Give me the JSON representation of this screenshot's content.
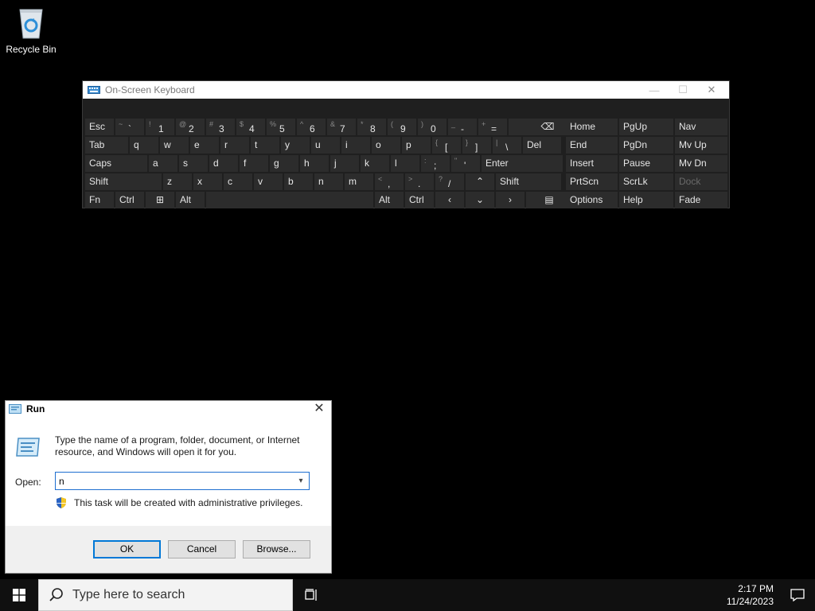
{
  "desktop": {
    "recycle_bin_label": "Recycle Bin"
  },
  "osk": {
    "title": "On-Screen Keyboard",
    "rows": [
      [
        {
          "label": "Esc"
        },
        {
          "shift": "~",
          "main": "`"
        },
        {
          "shift": "!",
          "main": "1"
        },
        {
          "shift": "@",
          "main": "2"
        },
        {
          "shift": "#",
          "main": "3"
        },
        {
          "shift": "$",
          "main": "4"
        },
        {
          "shift": "%",
          "main": "5"
        },
        {
          "shift": "^",
          "main": "6"
        },
        {
          "shift": "&",
          "main": "7"
        },
        {
          "shift": "*",
          "main": "8"
        },
        {
          "shift": "(",
          "main": "9"
        },
        {
          "shift": ")",
          "main": "0"
        },
        {
          "shift": "_",
          "main": "-"
        },
        {
          "shift": "+",
          "main": "="
        },
        {
          "label": "⌫",
          "icon": "backspace-icon"
        }
      ],
      [
        {
          "label": "Tab"
        },
        {
          "label": "q"
        },
        {
          "label": "w"
        },
        {
          "label": "e"
        },
        {
          "label": "r"
        },
        {
          "label": "t"
        },
        {
          "label": "y"
        },
        {
          "label": "u"
        },
        {
          "label": "i"
        },
        {
          "label": "o"
        },
        {
          "label": "p"
        },
        {
          "shift": "{",
          "main": "["
        },
        {
          "shift": "}",
          "main": "]"
        },
        {
          "shift": "|",
          "main": "\\"
        },
        {
          "label": "Del"
        }
      ],
      [
        {
          "label": "Caps"
        },
        {
          "label": "a"
        },
        {
          "label": "s"
        },
        {
          "label": "d"
        },
        {
          "label": "f"
        },
        {
          "label": "g"
        },
        {
          "label": "h"
        },
        {
          "label": "j"
        },
        {
          "label": "k"
        },
        {
          "label": "l"
        },
        {
          "shift": ":",
          "main": ";"
        },
        {
          "shift": "\"",
          "main": "'"
        },
        {
          "label": "Enter"
        }
      ],
      [
        {
          "label": "Shift"
        },
        {
          "label": "z"
        },
        {
          "label": "x"
        },
        {
          "label": "c"
        },
        {
          "label": "v"
        },
        {
          "label": "b"
        },
        {
          "label": "n"
        },
        {
          "label": "m"
        },
        {
          "shift": "<",
          "main": ","
        },
        {
          "shift": ">",
          "main": "."
        },
        {
          "shift": "?",
          "main": "/"
        },
        {
          "label": "⌃",
          "icon": "arrow-up-icon"
        },
        {
          "label": "Shift"
        }
      ],
      [
        {
          "label": "Fn"
        },
        {
          "label": "Ctrl"
        },
        {
          "label": "⊞",
          "icon": "windows-logo-icon"
        },
        {
          "label": "Alt"
        },
        {
          "label": "",
          "icon": "space-bar"
        },
        {
          "label": "Alt"
        },
        {
          "label": "Ctrl"
        },
        {
          "label": "‹",
          "icon": "arrow-left-icon"
        },
        {
          "label": "⌄",
          "icon": "arrow-down-icon"
        },
        {
          "label": "›",
          "icon": "arrow-right-icon"
        },
        {
          "label": "▤",
          "icon": "menu-key-icon"
        }
      ]
    ],
    "nav_keys": [
      [
        "Home",
        "PgUp",
        "Nav"
      ],
      [
        "End",
        "PgDn",
        "Mv Up"
      ],
      [
        "Insert",
        "Pause",
        "Mv Dn"
      ],
      [
        "PrtScn",
        "ScrLk",
        "Dock"
      ],
      [
        "Options",
        "Help",
        "Fade"
      ]
    ]
  },
  "run": {
    "title": "Run",
    "description": "Type the name of a program, folder, document, or Internet resource, and Windows will open it for you.",
    "open_label": "Open:",
    "open_value": "n",
    "admin_note": "This task will be created with administrative privileges.",
    "ok_label": "OK",
    "cancel_label": "Cancel",
    "browse_label": "Browse..."
  },
  "taskbar": {
    "search_placeholder": "Type here to search",
    "time": "2:17 PM",
    "date": "11/24/2023"
  }
}
